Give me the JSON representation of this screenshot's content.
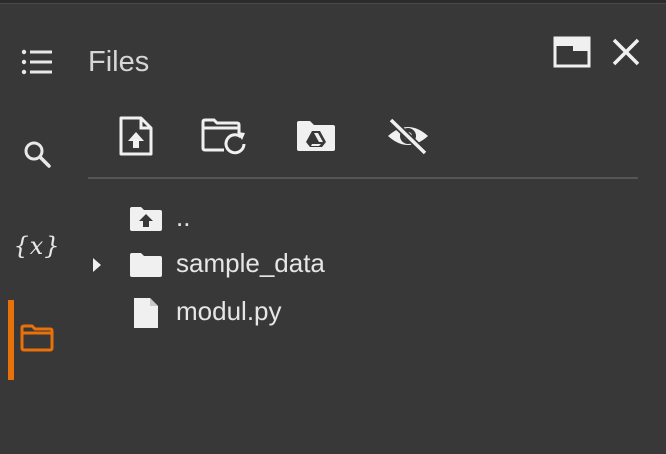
{
  "panel": {
    "title": "Files"
  },
  "rail": {
    "items": [
      {
        "name": "table-of-contents",
        "icon": "list-icon"
      },
      {
        "name": "find",
        "icon": "search-icon"
      },
      {
        "name": "variables",
        "icon": "variables-icon",
        "glyph": "{x}"
      },
      {
        "name": "files",
        "icon": "folder-icon",
        "active": true
      }
    ],
    "active_color": "#e8710a"
  },
  "header_actions": [
    {
      "name": "move-to-tab",
      "icon": "window-icon"
    },
    {
      "name": "close",
      "icon": "close-icon"
    }
  ],
  "toolbar": [
    {
      "name": "upload-file",
      "icon": "upload-file-icon"
    },
    {
      "name": "refresh",
      "icon": "folder-refresh-icon"
    },
    {
      "name": "mount-drive",
      "icon": "drive-folder-icon"
    },
    {
      "name": "toggle-hidden-files",
      "icon": "eye-off-icon"
    }
  ],
  "tree": [
    {
      "label": "..",
      "icon": "folder-up-icon",
      "expandable": false
    },
    {
      "label": "sample_data",
      "icon": "folder-icon",
      "expandable": true
    },
    {
      "label": "modul.py",
      "icon": "file-icon",
      "expandable": false
    }
  ]
}
